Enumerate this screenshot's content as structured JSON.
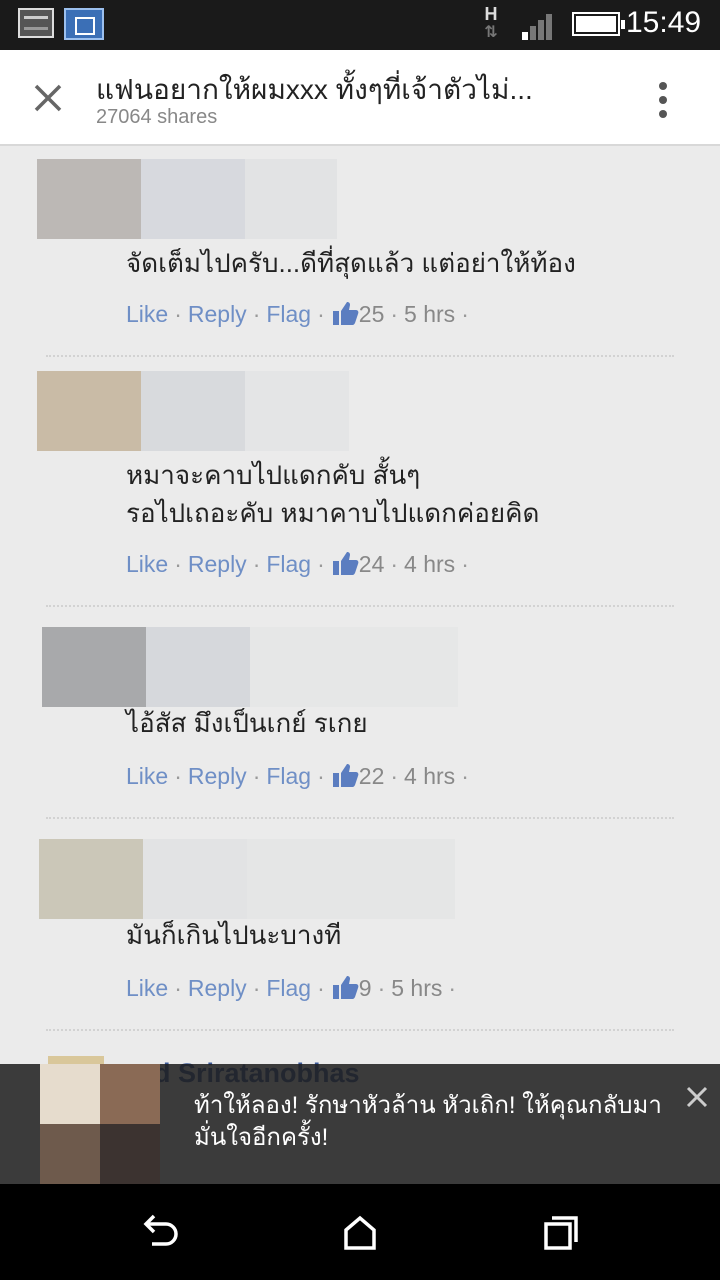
{
  "status_bar": {
    "time": "15:49",
    "network_type": "H",
    "network_arrows": "⇅",
    "icons": [
      "gallery-icon",
      "video-icon",
      "data-activity-icon",
      "signal-icon",
      "battery-icon"
    ]
  },
  "header": {
    "title": "แฟนอยากให้ผมxxx ทั้งๆที่เจ้าตัวไม่...",
    "shares": "27064 shares",
    "close_icon": "close-icon",
    "more_icon": "more-vertical-icon"
  },
  "comments": [
    {
      "text_lines": [
        "จัดเต็มไปครับ...ดีที่สุดแล้ว แต่อย่าให้ท้อง"
      ],
      "actions": {
        "like": "Like",
        "reply": "Reply",
        "flag": "Flag",
        "likes": "25",
        "time": "5 hrs"
      }
    },
    {
      "text_lines": [
        "หมาจะคาบไปแดกคับ สั้นๆ",
        "รอไปเถอะคับ หมาคาบไปแดกค่อยคิด"
      ],
      "actions": {
        "like": "Like",
        "reply": "Reply",
        "flag": "Flag",
        "likes": "24",
        "time": "4 hrs"
      }
    },
    {
      "text_lines": [
        "ไอ้สัส มึงเป็นเกย์ รเกย"
      ],
      "actions": {
        "like": "Like",
        "reply": "Reply",
        "flag": "Flag",
        "likes": "22",
        "time": "4 hrs"
      }
    },
    {
      "text_lines": [
        "มันก็เกินไปนะบางที"
      ],
      "actions": {
        "like": "Like",
        "reply": "Reply",
        "flag": "Flag",
        "likes": "9",
        "time": "5 hrs"
      }
    }
  ],
  "partial_comment": {
    "author": "d Sriratanobhas"
  },
  "ad": {
    "text": "ท้าให้ลอง! รักษาหัวล้าน หัวเถิก! ให้คุณกลับมามั่นใจอีกครั้ง!",
    "close_icon": "close-icon"
  },
  "nav": {
    "back_icon": "back-icon",
    "home_icon": "home-icon",
    "recents_icon": "recent-apps-icon"
  },
  "colors": {
    "link": "#6f8fc6",
    "author": "#3b5998",
    "status_bar": "#1a1a1a",
    "background": "#ebebeb"
  }
}
